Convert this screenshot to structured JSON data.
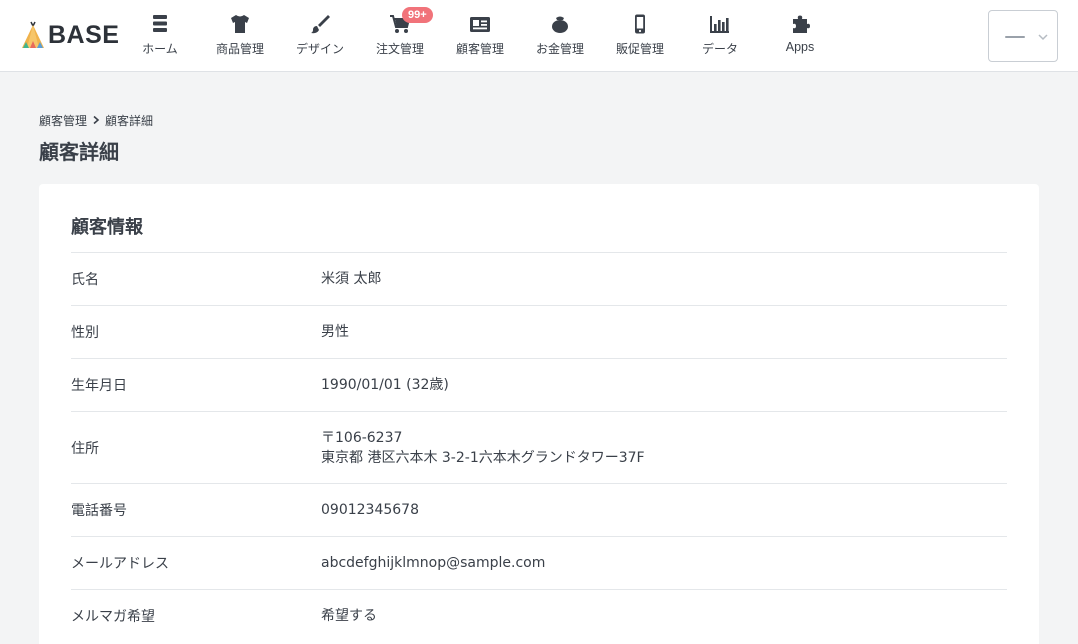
{
  "header": {
    "logo_text": "BASE",
    "nav": [
      {
        "label": "ホーム",
        "icon": "list-icon"
      },
      {
        "label": "商品管理",
        "icon": "tshirt-icon"
      },
      {
        "label": "デザイン",
        "icon": "brush-icon"
      },
      {
        "label": "注文管理",
        "icon": "cart-icon",
        "badge": "99+"
      },
      {
        "label": "顧客管理",
        "icon": "id-card-icon"
      },
      {
        "label": "お金管理",
        "icon": "coin-purse-icon"
      },
      {
        "label": "販促管理",
        "icon": "smartphone-icon"
      },
      {
        "label": "データ",
        "icon": "bar-chart-icon"
      },
      {
        "label": "Apps",
        "icon": "puzzle-icon"
      }
    ]
  },
  "breadcrumb": {
    "parent": "顧客管理",
    "current": "顧客詳細"
  },
  "page_title": "顧客詳細",
  "customer": {
    "section_title": "顧客情報",
    "rows": [
      {
        "label": "氏名",
        "value": "米須 太郎"
      },
      {
        "label": "性別",
        "value": "男性"
      },
      {
        "label": "生年月日",
        "value": "1990/01/01 (32歳)"
      },
      {
        "label": "住所",
        "value_line1": "〒106-6237",
        "value_line2": "東京都 港区六本木 3-2-1六本木グランドタワー37F"
      },
      {
        "label": "電話番号",
        "value": "09012345678"
      },
      {
        "label": "メールアドレス",
        "value": "abcdefghijklmnop@sample.com"
      },
      {
        "label": "メルマガ希望",
        "value": "希望する"
      }
    ]
  },
  "colors": {
    "badge": "#f1737a",
    "background": "#f3f4f5",
    "text": "#3a4049"
  }
}
